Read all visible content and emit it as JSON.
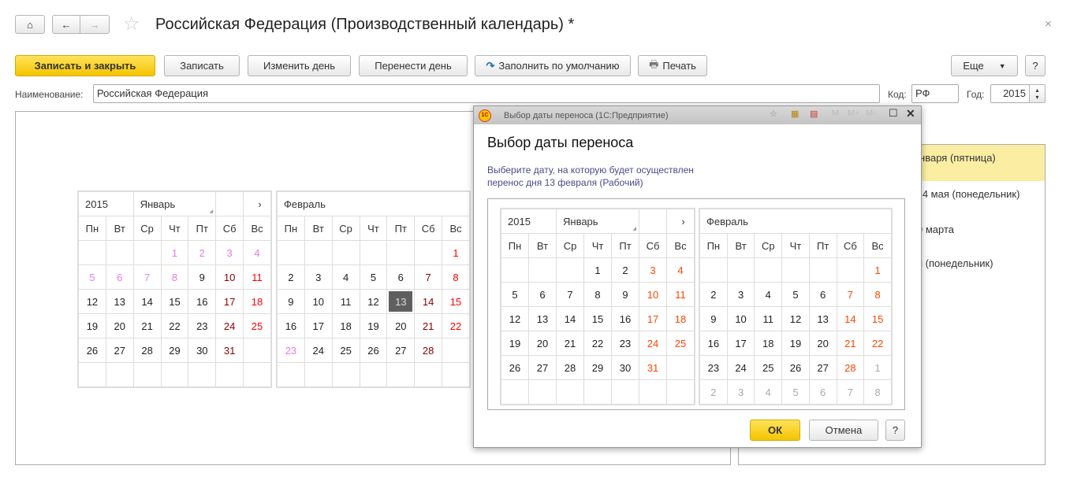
{
  "window": {
    "title": "Российская Федерация (Производственный календарь) *",
    "close": "×"
  },
  "toolbar": {
    "save_close": "Записать и закрыть",
    "save": "Записать",
    "change_day": "Изменить день",
    "move_day": "Перенести день",
    "fill_default": "Заполнить по умолчанию",
    "print": "Печать",
    "more": "Еще",
    "help": "?"
  },
  "form": {
    "name_label": "Наименование:",
    "name_value": "Российская Федерация",
    "code_label": "Код:",
    "code_value": "РФ",
    "year_label": "Год:",
    "year_value": "2015"
  },
  "transfers": [
    "января (пятница)",
    "а 4 мая (понедельник)",
    "9 марта",
    "я (понедельник)"
  ],
  "weekdays": [
    "Пн",
    "Вт",
    "Ср",
    "Чт",
    "Пт",
    "Сб",
    "Вс"
  ],
  "colors": {
    "holiday": "#e57ce5",
    "saturday": "#8b0000",
    "sunday": "#ff0000",
    "weekend_dialog": "#ff4500",
    "other_month": "#aaaaaa",
    "selected": "#5f5f5f",
    "accent": "#f5c400"
  },
  "main_calendar": {
    "year": "2015",
    "next": "›",
    "months": [
      {
        "name": "Январь",
        "weeks": [
          [
            null,
            null,
            null,
            [
              1,
              "h"
            ],
            [
              2,
              "h"
            ],
            [
              3,
              "h"
            ],
            [
              4,
              "h"
            ]
          ],
          [
            [
              5,
              "h"
            ],
            [
              6,
              "h"
            ],
            [
              7,
              "h"
            ],
            [
              8,
              "h"
            ],
            [
              9,
              "w"
            ],
            [
              10,
              "s"
            ],
            [
              11,
              "u"
            ]
          ],
          [
            [
              12,
              "w"
            ],
            [
              13,
              "w"
            ],
            [
              14,
              "w"
            ],
            [
              15,
              "w"
            ],
            [
              16,
              "w"
            ],
            [
              17,
              "s"
            ],
            [
              18,
              "u"
            ]
          ],
          [
            [
              19,
              "w"
            ],
            [
              20,
              "w"
            ],
            [
              21,
              "w"
            ],
            [
              22,
              "w"
            ],
            [
              23,
              "w"
            ],
            [
              24,
              "s"
            ],
            [
              25,
              "u"
            ]
          ],
          [
            [
              26,
              "w"
            ],
            [
              27,
              "w"
            ],
            [
              28,
              "w"
            ],
            [
              29,
              "w"
            ],
            [
              30,
              "w"
            ],
            [
              31,
              "s"
            ],
            null
          ],
          [
            null,
            null,
            null,
            null,
            null,
            null,
            null
          ]
        ]
      },
      {
        "name": "Февраль",
        "weeks": [
          [
            null,
            null,
            null,
            null,
            null,
            null,
            [
              1,
              "u"
            ]
          ],
          [
            [
              2,
              "w"
            ],
            [
              3,
              "w"
            ],
            [
              4,
              "w"
            ],
            [
              5,
              "w"
            ],
            [
              6,
              "w"
            ],
            [
              7,
              "s"
            ],
            [
              8,
              "u"
            ]
          ],
          [
            [
              9,
              "w"
            ],
            [
              10,
              "w"
            ],
            [
              11,
              "w"
            ],
            [
              12,
              "w"
            ],
            [
              13,
              "sel"
            ],
            [
              14,
              "s"
            ],
            [
              15,
              "u"
            ]
          ],
          [
            [
              16,
              "w"
            ],
            [
              17,
              "w"
            ],
            [
              18,
              "w"
            ],
            [
              19,
              "w"
            ],
            [
              20,
              "w"
            ],
            [
              21,
              "s"
            ],
            [
              22,
              "u"
            ]
          ],
          [
            [
              23,
              "h"
            ],
            [
              24,
              "w"
            ],
            [
              25,
              "w"
            ],
            [
              26,
              "w"
            ],
            [
              27,
              "w"
            ],
            [
              28,
              "s"
            ],
            null
          ],
          [
            null,
            null,
            null,
            null,
            null,
            null,
            null
          ]
        ]
      }
    ]
  },
  "dialog": {
    "window_title": "Выбор даты переноса  (1С:Предприятие)",
    "heading": "Выбор даты переноса",
    "text_line1": "Выберите дату, на которую будет осуществлен",
    "text_line2": "перенос дня 13 февраля (Рабочий)",
    "ok": "ОК",
    "cancel": "Отмена",
    "help": "?",
    "memory": [
      "M",
      "M+",
      "M-"
    ],
    "calendar": {
      "year": "2015",
      "next": "›",
      "months": [
        {
          "name": "Январь",
          "weeks": [
            [
              null,
              null,
              null,
              [
                1,
                "w"
              ],
              [
                2,
                "w"
              ],
              [
                3,
                "r"
              ],
              [
                4,
                "r"
              ]
            ],
            [
              [
                5,
                "w"
              ],
              [
                6,
                "w"
              ],
              [
                7,
                "w"
              ],
              [
                8,
                "w"
              ],
              [
                9,
                "w"
              ],
              [
                10,
                "r"
              ],
              [
                11,
                "r"
              ]
            ],
            [
              [
                12,
                "w"
              ],
              [
                13,
                "w"
              ],
              [
                14,
                "w"
              ],
              [
                15,
                "w"
              ],
              [
                16,
                "w"
              ],
              [
                17,
                "r"
              ],
              [
                18,
                "r"
              ]
            ],
            [
              [
                19,
                "w"
              ],
              [
                20,
                "w"
              ],
              [
                21,
                "w"
              ],
              [
                22,
                "w"
              ],
              [
                23,
                "w"
              ],
              [
                24,
                "r"
              ],
              [
                25,
                "r"
              ]
            ],
            [
              [
                26,
                "w"
              ],
              [
                27,
                "w"
              ],
              [
                28,
                "w"
              ],
              [
                29,
                "w"
              ],
              [
                30,
                "w"
              ],
              [
                31,
                "r"
              ],
              null
            ],
            [
              null,
              null,
              null,
              null,
              null,
              null,
              null
            ]
          ]
        },
        {
          "name": "Февраль",
          "weeks": [
            [
              null,
              null,
              null,
              null,
              null,
              null,
              [
                1,
                "r"
              ]
            ],
            [
              [
                2,
                "w"
              ],
              [
                3,
                "w"
              ],
              [
                4,
                "w"
              ],
              [
                5,
                "w"
              ],
              [
                6,
                "w"
              ],
              [
                7,
                "r"
              ],
              [
                8,
                "r"
              ]
            ],
            [
              [
                9,
                "w"
              ],
              [
                10,
                "w"
              ],
              [
                11,
                "w"
              ],
              [
                12,
                "w"
              ],
              [
                13,
                "w"
              ],
              [
                14,
                "r"
              ],
              [
                15,
                "r"
              ]
            ],
            [
              [
                16,
                "w"
              ],
              [
                17,
                "w"
              ],
              [
                18,
                "w"
              ],
              [
                19,
                "w"
              ],
              [
                20,
                "w"
              ],
              [
                21,
                "r"
              ],
              [
                22,
                "r"
              ]
            ],
            [
              [
                23,
                "w"
              ],
              [
                24,
                "w"
              ],
              [
                25,
                "w"
              ],
              [
                26,
                "w"
              ],
              [
                27,
                "w"
              ],
              [
                28,
                "r"
              ],
              [
                1,
                "o"
              ]
            ],
            [
              [
                2,
                "o"
              ],
              [
                3,
                "o"
              ],
              [
                4,
                "o"
              ],
              [
                5,
                "o"
              ],
              [
                6,
                "o"
              ],
              [
                7,
                "o"
              ],
              [
                8,
                "o"
              ]
            ]
          ]
        }
      ]
    }
  }
}
